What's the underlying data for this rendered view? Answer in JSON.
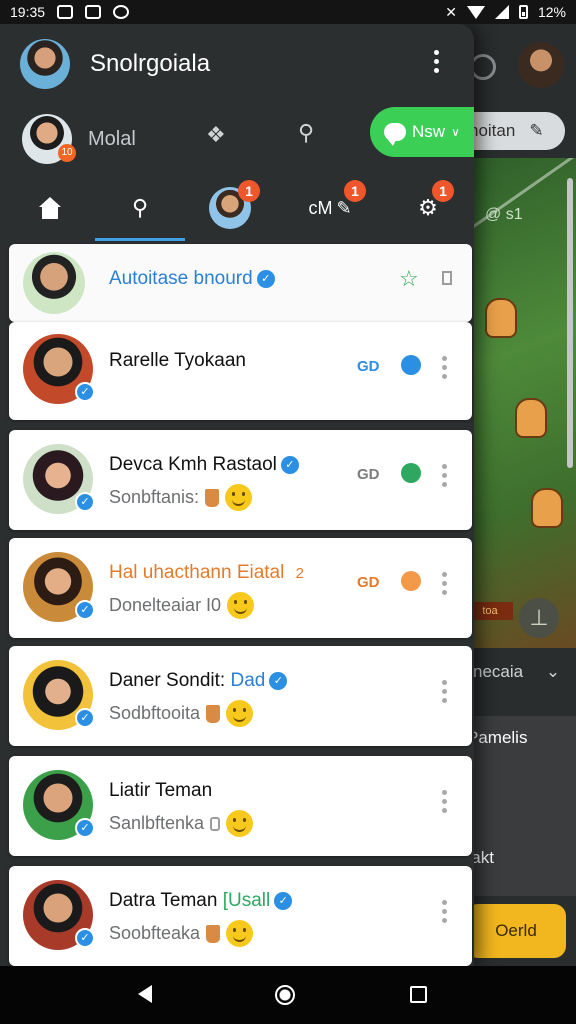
{
  "status_bar": {
    "time": "19:35",
    "battery": "12%"
  },
  "drawer": {
    "title": "Snolrgoiala",
    "account_name": "Molal",
    "account_badge": "10",
    "new_button": "Nsw",
    "nav_badges": [
      "1",
      "1",
      "1"
    ],
    "nav_label": "cM"
  },
  "background": {
    "pill_label": "noitan",
    "game_text": "@ s1",
    "game_tag": "toa",
    "row1": "necaia",
    "row2": "Pamelis",
    "row3": "Hakt",
    "cta": "Oerld"
  },
  "contacts": [
    {
      "name": "Autoitase bnourd",
      "sub": "",
      "verified_inline": true,
      "name_color": "#2b7fd4"
    },
    {
      "name": "Rarelle Tyokaan",
      "sub": "",
      "verified_inline": false,
      "name_color": "#111111"
    },
    {
      "name": "Devca Kmh Rastaol",
      "sub": "Sonbftanis:",
      "verified_inline": true,
      "name_color": "#111111"
    },
    {
      "name": "Hal uhacthann Eiatal",
      "name_suffix": "2",
      "sub": "Donelteaiar I0",
      "verified_inline": false,
      "name_color": "#e37b2a"
    },
    {
      "name": "Daner Sondit:",
      "name_suffix": "Dad",
      "sub": "Sodbftooita",
      "verified_inline": true,
      "name_color": "#111111"
    },
    {
      "name": "Liatir Teman",
      "sub": "Sanlbftenka",
      "verified_inline": false,
      "name_color": "#111111"
    },
    {
      "name": "Datra Teman",
      "name_suffix": "[Usall",
      "sub": "Soobfteaka",
      "verified_inline": true,
      "name_color": "#111111"
    }
  ],
  "control_label": "GD",
  "colors": {
    "accent": "#3fa0e6",
    "new_green": "#3ccf56",
    "badge": "#f0562b",
    "cta": "#f2b61e"
  }
}
